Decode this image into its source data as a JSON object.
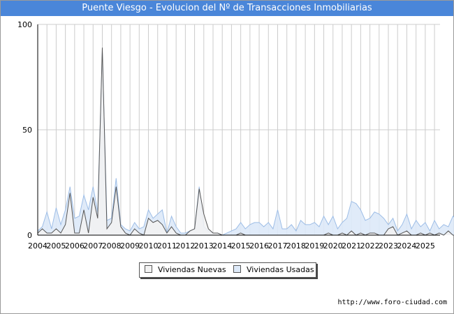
{
  "page": {
    "title": "Puente Viesgo - Evolucion del Nº de Transacciones Inmobiliarias",
    "source_url": "http://www.foro-ciudad.com"
  },
  "legend": {
    "nuevas": "Viviendas Nuevas",
    "usadas": "Viviendas Usadas"
  },
  "colors": {
    "title_bg": "#4a86d9",
    "nuevas_fill": "#f2f2f2",
    "nuevas_line": "#555555",
    "usadas_fill": "#dde9f8",
    "usadas_line": "#9dbde6",
    "grid": "#cccccc"
  },
  "chart_data": {
    "type": "area",
    "title": "Puente Viesgo - Evolucion del Nº de Transacciones Inmobiliarias",
    "x_unit": "quarter",
    "x_start": "2004-Q1",
    "categories": [
      "2004",
      "2005",
      "2006",
      "2007",
      "2008",
      "2009",
      "2010",
      "2011",
      "2012",
      "2013",
      "2014",
      "2015",
      "2016",
      "2017",
      "2018",
      "2019",
      "2020",
      "2021",
      "2022",
      "2023",
      "2024",
      "2025"
    ],
    "yticks": [
      0,
      50,
      100
    ],
    "ylim": [
      0,
      100
    ],
    "grid": true,
    "legend_position": "bottom-center",
    "series": [
      {
        "name": "Viviendas Nuevas",
        "values": [
          1,
          3,
          1,
          1,
          3,
          1,
          5,
          20,
          1,
          1,
          12,
          1,
          18,
          8,
          89,
          3,
          6,
          23,
          4,
          1,
          0,
          3,
          1,
          0,
          8,
          6,
          7,
          5,
          1,
          4,
          1,
          0,
          0,
          2,
          3,
          22,
          10,
          3,
          1,
          1,
          0,
          0,
          0,
          0,
          1,
          0,
          0,
          0,
          0,
          0,
          0,
          0,
          0,
          0,
          0,
          0,
          0,
          0,
          0,
          0,
          0,
          0,
          0,
          1,
          0,
          0,
          1,
          0,
          2,
          0,
          1,
          0,
          1,
          1,
          0,
          0,
          3,
          4,
          0,
          1,
          2,
          0,
          0,
          1,
          0,
          1,
          0,
          1,
          0,
          2,
          0,
          0,
          1,
          3
        ]
      },
      {
        "name": "Viviendas Usadas",
        "values": [
          2,
          4,
          11,
          3,
          13,
          5,
          12,
          23,
          8,
          9,
          19,
          12,
          23,
          11,
          87,
          7,
          8,
          27,
          5,
          3,
          2,
          6,
          3,
          4,
          12,
          8,
          10,
          12,
          1,
          9,
          4,
          1,
          1,
          2,
          3,
          23,
          4,
          2,
          1,
          1,
          0,
          1,
          2,
          3,
          6,
          3,
          5,
          6,
          6,
          4,
          6,
          3,
          12,
          3,
          3,
          5,
          2,
          7,
          5,
          5,
          6,
          4,
          9,
          5,
          9,
          3,
          6,
          8,
          16,
          15,
          12,
          7,
          8,
          11,
          10,
          8,
          5,
          8,
          2,
          5,
          10,
          3,
          7,
          4,
          6,
          2,
          7,
          3,
          5,
          4,
          9,
          7
        ]
      }
    ]
  }
}
